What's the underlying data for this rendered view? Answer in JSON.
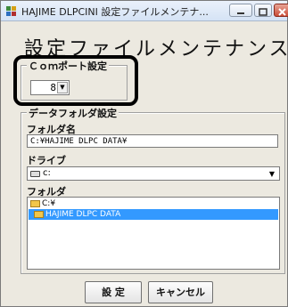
{
  "window": {
    "title": "HAJIME DLPCINI 設定ファイルメンテナ..."
  },
  "heading": "設定ファイルメンテナンス",
  "com_group": {
    "label": "Ｃｏｍポート設定",
    "port_value": "8"
  },
  "data_group": {
    "label": "データフォルダ設定",
    "folder_name_label": "フォルダ名",
    "folder_name_value": "C:¥HAJIME DLPC DATA¥",
    "drive_label": "ドライブ",
    "drive_value": "c:",
    "folder_label": "フォルダ",
    "folder_items": [
      {
        "label": "C:¥",
        "selected": false
      },
      {
        "label": "HAJIME DLPC DATA",
        "selected": true
      }
    ]
  },
  "buttons": {
    "ok": "設 定",
    "cancel": "キャンセル"
  },
  "colors": {
    "selection": "#3399ff",
    "close_button": "#c94b36"
  }
}
